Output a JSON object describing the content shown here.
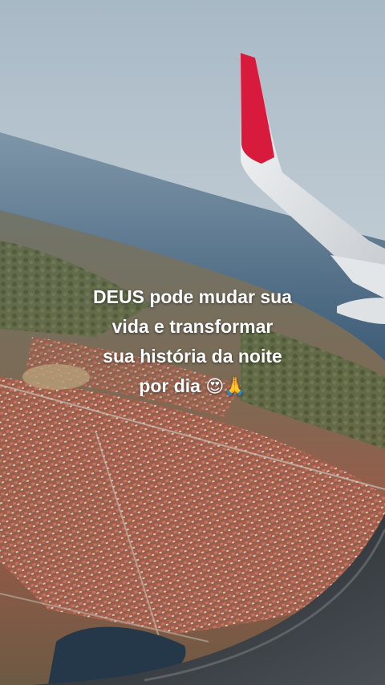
{
  "caption": {
    "line1": "DEUS pode mudar sua",
    "line2": "vida e transformar",
    "line3": "sua história da noite",
    "line4": "por dia",
    "emoji_1": "😍",
    "emoji_2": "🙏"
  },
  "scene": {
    "description_icons": [
      "airplane-wing",
      "window-frame",
      "city-below",
      "ocean",
      "sky"
    ]
  },
  "colors": {
    "sky_top": "#b9c6cf",
    "sky_bottom": "#d7dde1",
    "ocean": "#3f5f7c",
    "city": "#a9624f",
    "vegetation": "#5b6e3f",
    "wingtip_red": "#d81a3c",
    "wing_white": "#eef0f1",
    "window_frame": "#3b3f45"
  }
}
